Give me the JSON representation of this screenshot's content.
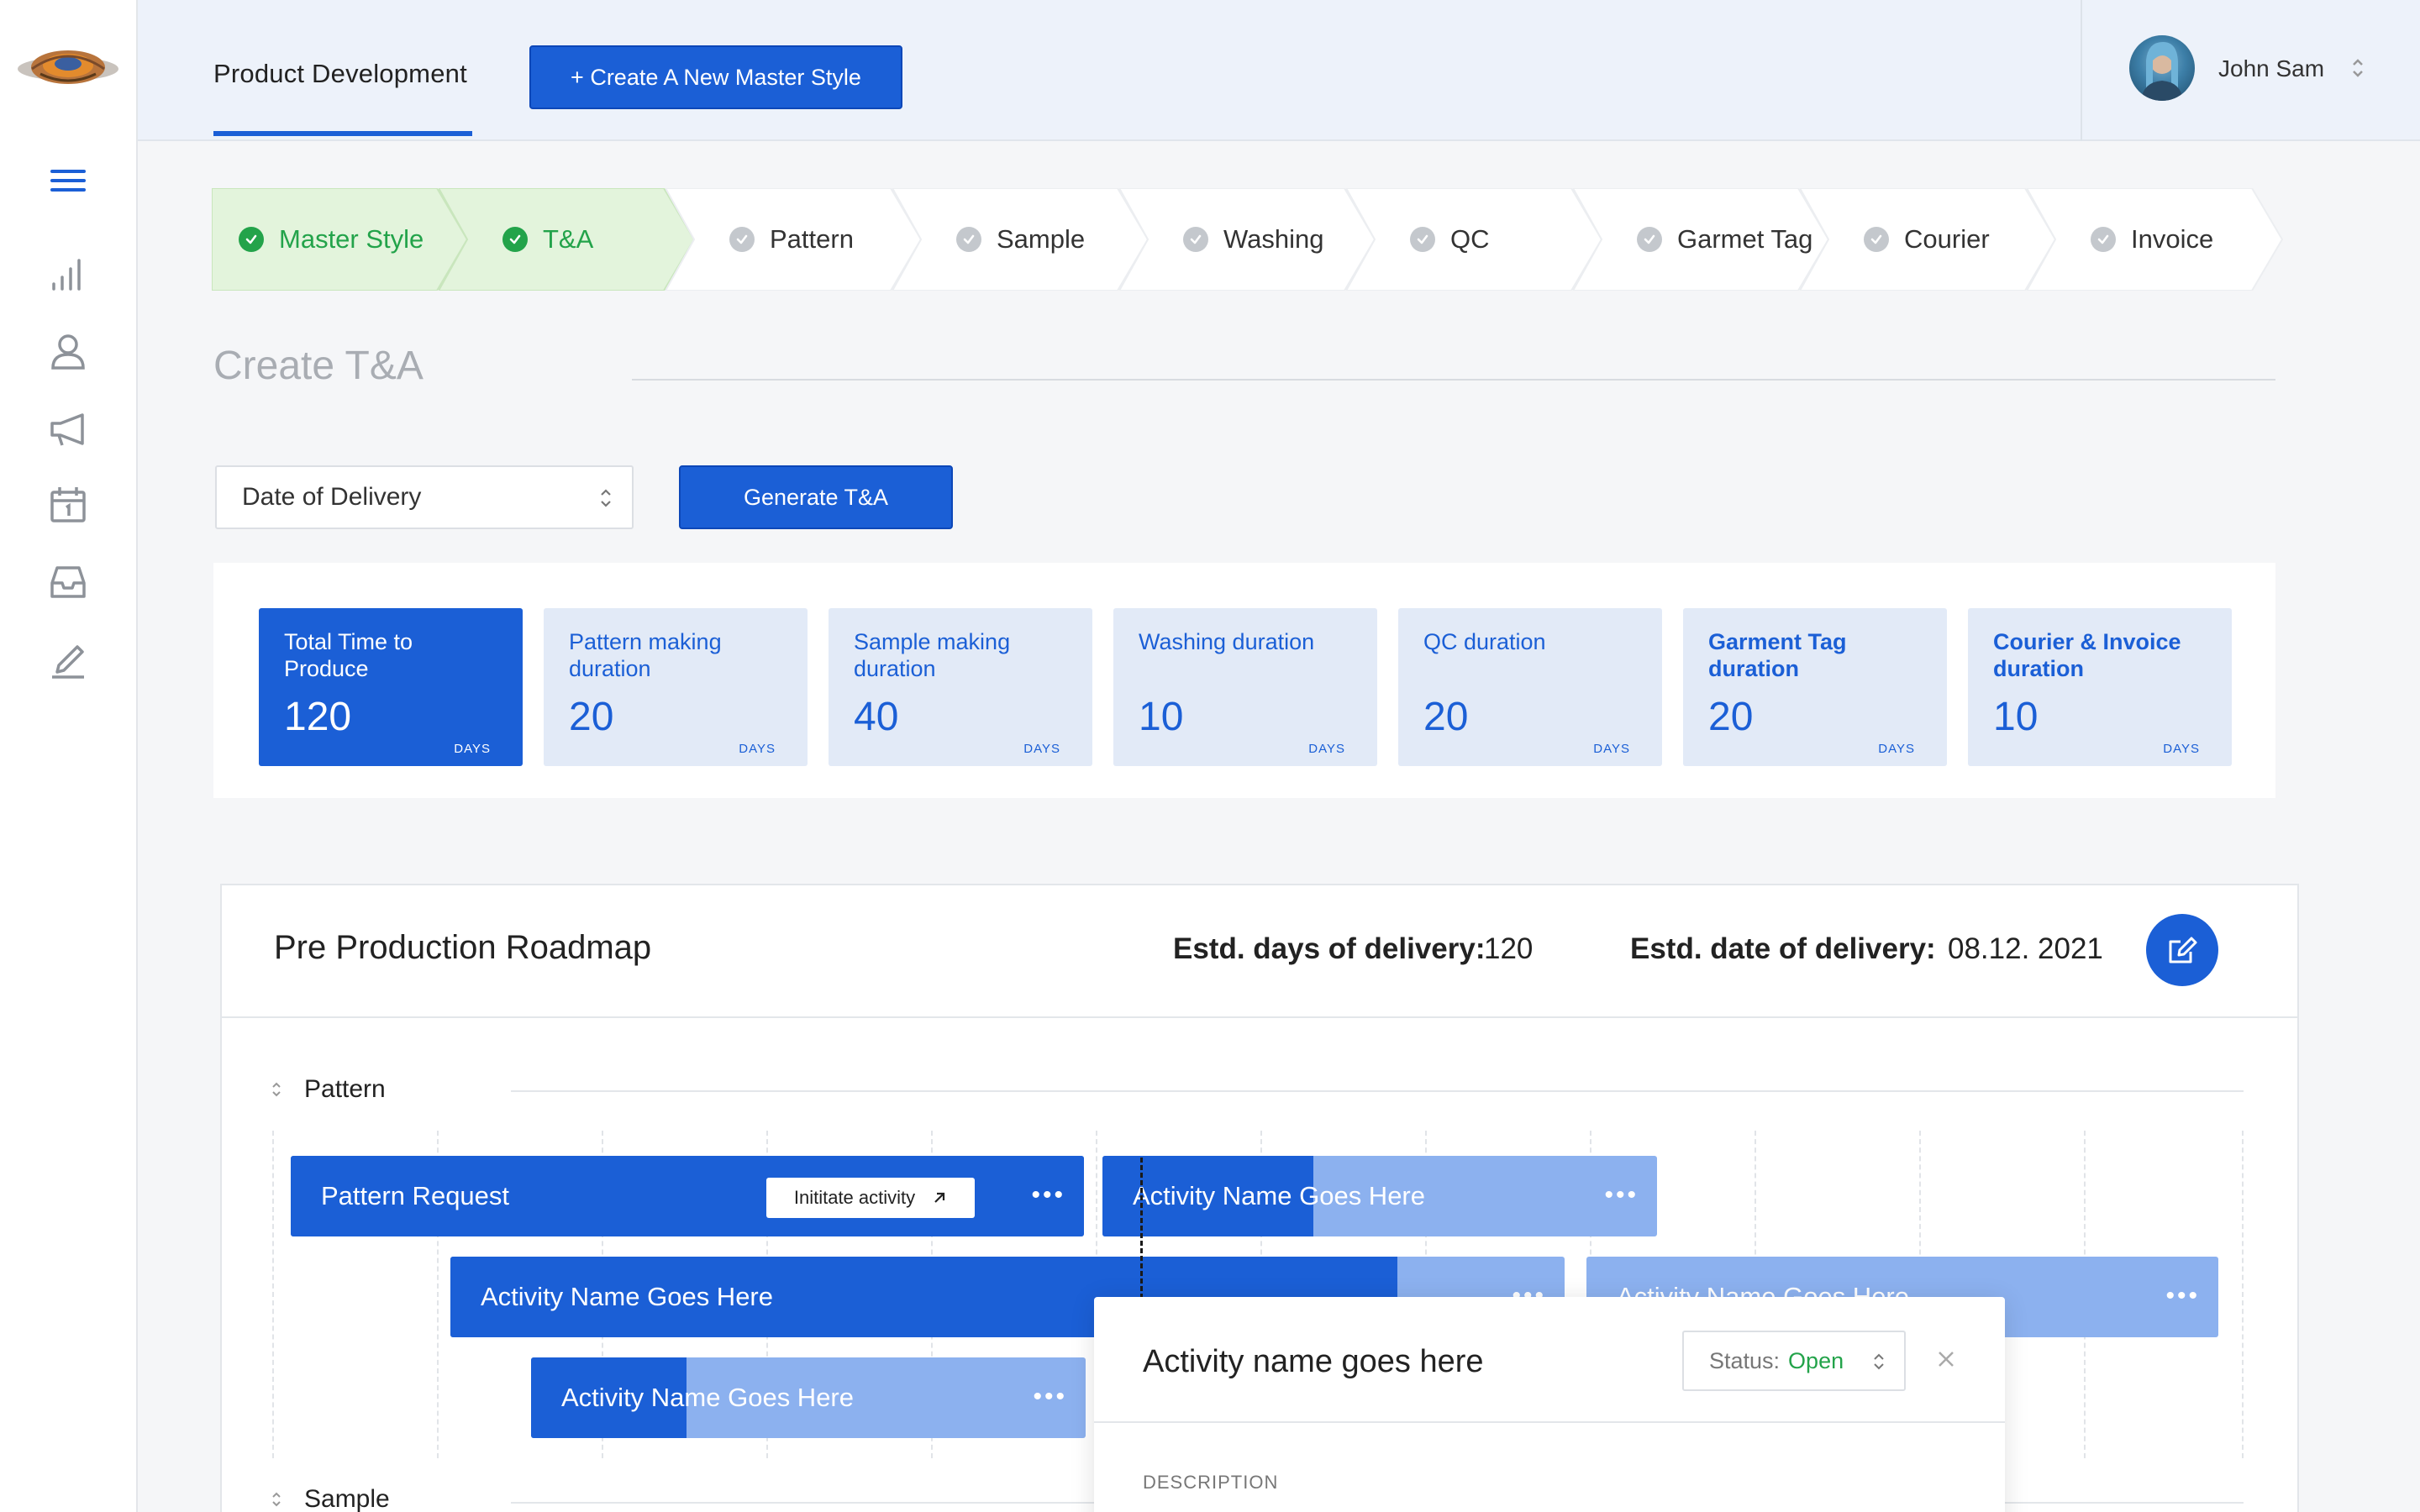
{
  "app": {
    "logo_icon": "company-logo",
    "accent": "#1b5fd6",
    "success": "#23a34a"
  },
  "sidebar": {
    "items": [
      {
        "icon": "menu-icon"
      },
      {
        "icon": "bar-chart-icon"
      },
      {
        "icon": "user-icon"
      },
      {
        "icon": "megaphone-icon"
      },
      {
        "icon": "calendar-icon"
      },
      {
        "icon": "inbox-icon"
      },
      {
        "icon": "pen-icon"
      }
    ]
  },
  "header": {
    "title": "Product Development",
    "create_button": "+ Create A New Master Style",
    "user_name": "John Sam"
  },
  "steps": [
    {
      "label": "Master Style",
      "done": true
    },
    {
      "label": "T&A",
      "done": true
    },
    {
      "label": "Pattern",
      "done": false
    },
    {
      "label": "Sample",
      "done": false
    },
    {
      "label": "Washing",
      "done": false
    },
    {
      "label": "QC",
      "done": false
    },
    {
      "label": "Garmet Tag",
      "done": false
    },
    {
      "label": "Courier",
      "done": false
    },
    {
      "label": "Invoice",
      "done": false
    }
  ],
  "create": {
    "title": "Create T&A",
    "select_value": "Date of Delivery",
    "generate_button": "Generate T&A"
  },
  "cards": [
    {
      "title": "Total Time to Produce",
      "value": "120",
      "unit": "DAYS"
    },
    {
      "title": "Pattern making duration",
      "value": "20",
      "unit": "DAYS"
    },
    {
      "title": "Sample making duration",
      "value": "40",
      "unit": "DAYS"
    },
    {
      "title": "Washing duration",
      "value": "10",
      "unit": "DAYS"
    },
    {
      "title": "QC duration",
      "value": "20",
      "unit": "DAYS"
    },
    {
      "title": "Garment Tag duration",
      "value": "20",
      "unit": "DAYS"
    },
    {
      "title": "Courier & Invoice duration",
      "value": "10",
      "unit": "DAYS"
    }
  ],
  "roadmap": {
    "title": "Pre Production Roadmap",
    "days_label": "Estd. days of delivery:",
    "days_value": "120",
    "date_label": "Estd. date of delivery:",
    "date_value": "08.12. 2021",
    "groups": [
      "Pattern",
      "Sample"
    ],
    "bars": [
      {
        "label": "Pattern Request",
        "progress": 1.0,
        "action": "Inititate activity"
      },
      {
        "label": "Activity Name Goes Here",
        "progress": 0.38
      },
      {
        "label": "Activity Name Goes Here",
        "progress": 0.85
      },
      {
        "label": "Activity Name Goes Here",
        "progress": 0.0
      },
      {
        "label": "Activity Name Goes Here",
        "progress": 0.28
      }
    ],
    "dots": "•••"
  },
  "popup": {
    "title": "Activity name goes here",
    "status_label": "Status:",
    "status_value": "Open",
    "description_label": "DESCRIPTION"
  }
}
